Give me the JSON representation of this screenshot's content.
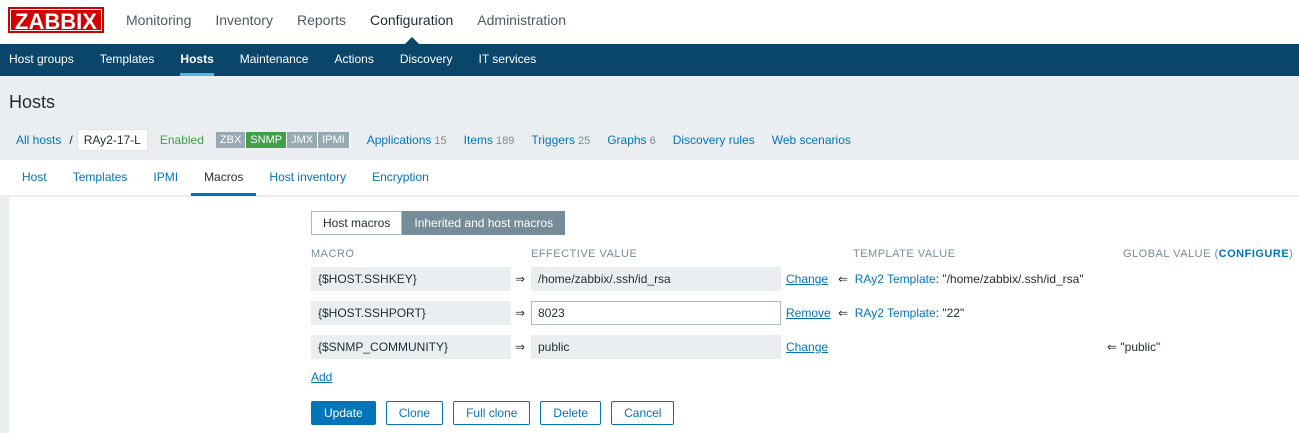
{
  "logo": "ZABBIX",
  "main_nav": [
    "Monitoring",
    "Inventory",
    "Reports",
    "Configuration",
    "Administration"
  ],
  "sub_nav": [
    "Host groups",
    "Templates",
    "Hosts",
    "Maintenance",
    "Actions",
    "Discovery",
    "IT services"
  ],
  "page_title": "Hosts",
  "breadcrumb": {
    "all_hosts": "All hosts",
    "separator": "/",
    "current_host": "RAy2-17-L",
    "status": "Enabled",
    "availability": [
      "ZBX",
      "SNMP",
      "JMX",
      "IPMI"
    ],
    "links": [
      {
        "label": "Applications",
        "count": "15"
      },
      {
        "label": "Items",
        "count": "189"
      },
      {
        "label": "Triggers",
        "count": "25"
      },
      {
        "label": "Graphs",
        "count": "6"
      },
      {
        "label": "Discovery rules",
        "count": ""
      },
      {
        "label": "Web scenarios",
        "count": ""
      }
    ]
  },
  "tabs": [
    "Host",
    "Templates",
    "IPMI",
    "Macros",
    "Host inventory",
    "Encryption"
  ],
  "selected_tab": "Macros",
  "macro_switch": {
    "host": "Host macros",
    "inherited": "Inherited and host macros"
  },
  "columns": {
    "macro": "MACRO",
    "effective": "EFFECTIVE VALUE",
    "template": "TEMPLATE VALUE",
    "global": "GLOBAL VALUE (",
    "configure": "CONFIGURE",
    "global_close": ")"
  },
  "rows": [
    {
      "macro": "{$HOST.SSHKEY}",
      "arrow": "⇒",
      "value": "/home/zabbix/.ssh/id_rsa",
      "action": "Change",
      "tmpl_arrow": "⇐",
      "template": "RAy2 Template",
      "template_value": ": \"/home/zabbix/.ssh/id_rsa\"",
      "global": ""
    },
    {
      "macro": "{$HOST.SSHPORT}",
      "arrow": "⇒",
      "value": "8023",
      "action": "Remove",
      "tmpl_arrow": "⇐",
      "template": "RAy2 Template",
      "template_value": ": \"22\"",
      "global": ""
    },
    {
      "macro": "{$SNMP_COMMUNITY}",
      "arrow": "⇒",
      "value": "public",
      "action": "Change",
      "tmpl_arrow": "",
      "template": "",
      "template_value": "",
      "global": "⇐ \"public\""
    }
  ],
  "add_label": "Add",
  "buttons": {
    "update": "Update",
    "clone": "Clone",
    "full_clone": "Full clone",
    "delete": "Delete",
    "cancel": "Cancel"
  },
  "colors": {
    "header_blue": "#0a466a",
    "link_blue": "#0275b8",
    "logo_red": "#d40000",
    "enabled_green": "#429e47",
    "switch_active": "#768d99"
  }
}
